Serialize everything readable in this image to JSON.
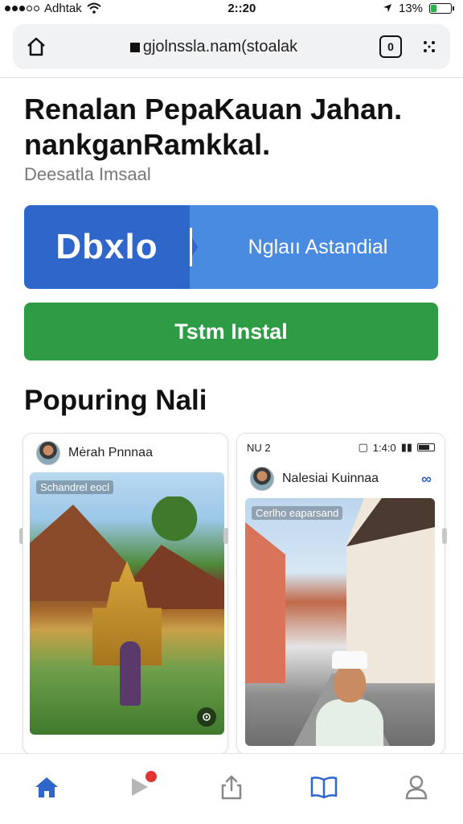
{
  "status_bar": {
    "carrier": "Adhtak",
    "time": "2::20",
    "battery": "13%",
    "battery_level": 0.3
  },
  "browser": {
    "url": "gjolnssla.nam(stoalak",
    "tab_count": "0"
  },
  "main": {
    "headline": "Renalan PepaKauan Jahan. nankganRamkkal.",
    "subtitle": "Deesatla Imsaal",
    "primary_cta": {
      "logo_text": "Dbxlo",
      "label": "Nglaıı Astandial",
      "color": "#2f66c9"
    },
    "install_button": {
      "label": "Tstm Instal",
      "color": "#2e9b45"
    },
    "section_title": "Popuring Nali"
  },
  "cards": [
    {
      "author": "Mėrah Pnnnaa",
      "image_caption": "Schandrel eocl"
    },
    {
      "inner_status_left": "NU 2",
      "inner_status_time": "1:4:0",
      "author": "Nalesiai Kuinnaa",
      "image_caption": "Cerlho eaparsand"
    }
  ],
  "bottom_nav": {
    "items": [
      "home-icon",
      "play-icon",
      "share-icon",
      "book-icon",
      "profile-icon"
    ],
    "active": "home-icon",
    "active_color": "#2f66c9"
  }
}
